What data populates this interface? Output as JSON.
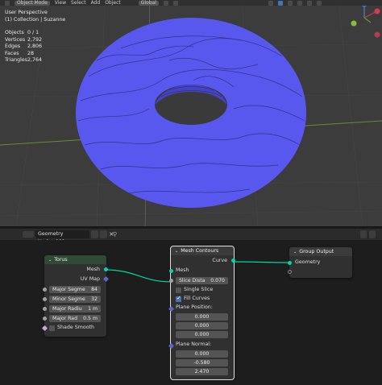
{
  "viewport": {
    "header": {
      "mode": "Object Mode",
      "menu": [
        "View",
        "Select",
        "Add",
        "Object"
      ],
      "transform": "Global"
    },
    "info": {
      "line1": "User Perspective",
      "line2": "(1) Collection | Suzanne"
    },
    "stats": [
      {
        "label": "Objects",
        "value": "0 / 1"
      },
      {
        "label": "Vertices",
        "value": "2,792"
      },
      {
        "label": "Edges",
        "value": "2,806"
      },
      {
        "label": "Faces",
        "value": "28"
      },
      {
        "label": "Triangles",
        "value": "2,764"
      }
    ],
    "mesh_color": "#5b5bf0"
  },
  "node_editor": {
    "tree_name": "Geometry Nodes.001",
    "nodes": {
      "torus": {
        "title": "Torus",
        "out_mesh": "Mesh",
        "out_uv": "UV Map",
        "inputs": [
          {
            "label": "Major Segme",
            "value": "84"
          },
          {
            "label": "Minor Segme",
            "value": "32"
          },
          {
            "label": "Major Radiu",
            "value": "1 m"
          },
          {
            "label": "Major Rad",
            "value": "0.5 m"
          }
        ],
        "shade_smooth": "Shade Smooth"
      },
      "contours": {
        "title": "Mesh Contours",
        "out_curve": "Curve",
        "in_mesh": "Mesh",
        "slice_label": "Slice Dista",
        "slice_value": "0.070",
        "single_slice": "Single Slice",
        "fill_curves": "Fill Curves",
        "plane_position": "Plane Position:",
        "position": [
          "0.000",
          "0.000",
          "0.000"
        ],
        "plane_normal": "Plane Normal:",
        "normal": [
          "0.000",
          "-0.580",
          "2.470"
        ]
      },
      "output": {
        "title": "Group Output",
        "geometry": "Geometry"
      }
    }
  }
}
